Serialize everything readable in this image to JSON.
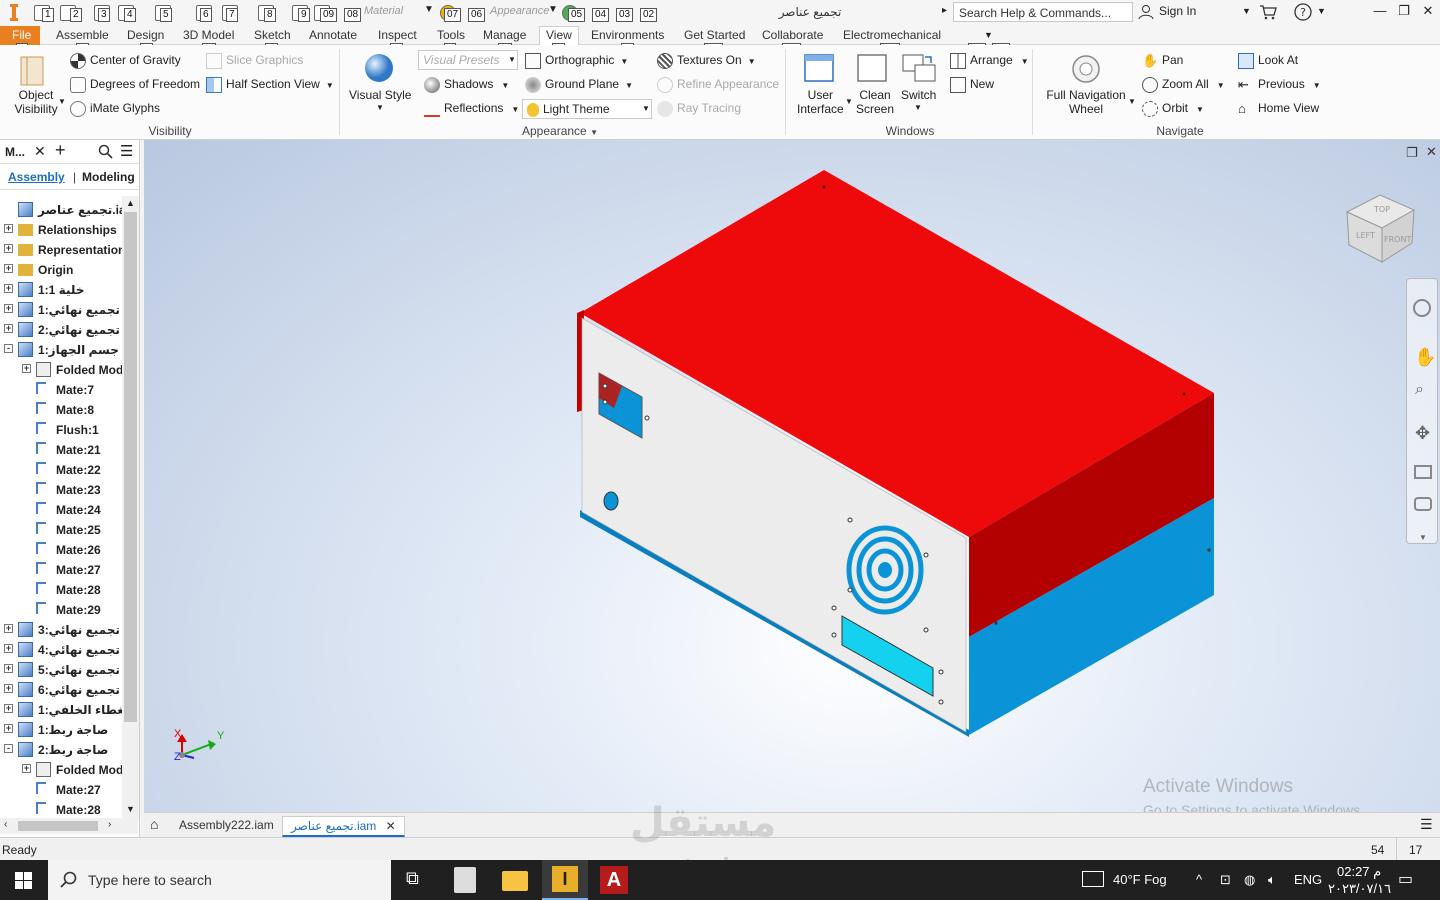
{
  "app": {
    "title": "تجميع عناصر",
    "search_placeholder": "Search Help & Commands...",
    "sign_in": "Sign In",
    "qat_combo1": "Material",
    "qat_combo2": "Appearance",
    "accent": "#e8801f"
  },
  "keytips": {
    "qat": [
      "1",
      "2",
      "3",
      "4",
      "5",
      "6",
      "7",
      "8",
      "9",
      "09",
      "08",
      "07",
      "06",
      "05",
      "04",
      "03",
      "02"
    ],
    "tabs": [
      "F",
      "A",
      "D",
      "M",
      "S",
      "N",
      "T",
      "G",
      "V",
      "E",
      "ZS",
      "OL",
      "ZM",
      "X2",
      "X3"
    ]
  },
  "tabs": [
    {
      "label": "File"
    },
    {
      "label": "Assemble"
    },
    {
      "label": "Design"
    },
    {
      "label": "3D Model"
    },
    {
      "label": "Sketch"
    },
    {
      "label": "Annotate"
    },
    {
      "label": "Inspect"
    },
    {
      "label": "Tools"
    },
    {
      "label": "Manage"
    },
    {
      "label": "View"
    },
    {
      "label": "Environments"
    },
    {
      "label": "Get Started"
    },
    {
      "label": "Collaborate"
    },
    {
      "label": "Electromechanical"
    }
  ],
  "ribbon": {
    "visibility": {
      "object_visibility": "Object\nVisibility",
      "center_gravity": "Center of Gravity",
      "degrees_freedom": "Degrees of Freedom",
      "imate_glyphs": "iMate Glyphs",
      "slice_graphics": "Slice Graphics",
      "half_section": "Half Section View",
      "group": "Visibility"
    },
    "appearance": {
      "visual_style": "Visual Style",
      "visual_presets": "Visual Presets",
      "shadows": "Shadows",
      "reflections": "Reflections",
      "orthographic": "Orthographic",
      "ground_plane": "Ground Plane",
      "light_theme": "Light Theme",
      "textures_on": "Textures On",
      "refine_appearance": "Refine Appearance",
      "ray_tracing": "Ray Tracing",
      "group": "Appearance"
    },
    "windows": {
      "user_interface": "User\nInterface",
      "clean_screen": "Clean\nScreen",
      "switch": "Switch",
      "arrange": "Arrange",
      "new": "New",
      "group": "Windows"
    },
    "navigate": {
      "full_nav_wheel": "Full Navigation\nWheel",
      "pan": "Pan",
      "zoom_all": "Zoom All",
      "orbit": "Orbit",
      "look_at": "Look At",
      "previous": "Previous",
      "home_view": "Home View",
      "group": "Navigate"
    }
  },
  "browser": {
    "title": "M...",
    "tab_assembly": "Assembly",
    "tab_modeling": "Modeling",
    "rows": [
      {
        "label": "تجميع عناصر.iam",
        "kind": "asm",
        "indent": 0,
        "toggle": ""
      },
      {
        "label": "Relationships",
        "kind": "folder",
        "indent": 0,
        "toggle": "+"
      },
      {
        "label": "Representations",
        "kind": "folder",
        "indent": 0,
        "toggle": "+"
      },
      {
        "label": "Origin",
        "kind": "folder",
        "indent": 0,
        "toggle": "+"
      },
      {
        "label": "خلية 1:1",
        "kind": "part",
        "indent": 0,
        "toggle": "+"
      },
      {
        "label": "تجميع نهائي:1",
        "kind": "asm",
        "indent": 0,
        "toggle": "+"
      },
      {
        "label": "تجميع نهائي:2",
        "kind": "asm",
        "indent": 0,
        "toggle": "+"
      },
      {
        "label": "جسم الجهاز:1",
        "kind": "part",
        "indent": 0,
        "toggle": "-"
      },
      {
        "label": "Folded Model",
        "kind": "folded",
        "indent": 1,
        "toggle": "+"
      },
      {
        "label": "Mate:7",
        "kind": "mate",
        "indent": 1,
        "toggle": ""
      },
      {
        "label": "Mate:8",
        "kind": "mate",
        "indent": 1,
        "toggle": ""
      },
      {
        "label": "Flush:1",
        "kind": "flush",
        "indent": 1,
        "toggle": ""
      },
      {
        "label": "Mate:21",
        "kind": "mate",
        "indent": 1,
        "toggle": ""
      },
      {
        "label": "Mate:22",
        "kind": "mate2",
        "indent": 1,
        "toggle": ""
      },
      {
        "label": "Mate:23",
        "kind": "mate",
        "indent": 1,
        "toggle": ""
      },
      {
        "label": "Mate:24",
        "kind": "mate",
        "indent": 1,
        "toggle": ""
      },
      {
        "label": "Mate:25",
        "kind": "mate2",
        "indent": 1,
        "toggle": ""
      },
      {
        "label": "Mate:26",
        "kind": "mate",
        "indent": 1,
        "toggle": ""
      },
      {
        "label": "Mate:27",
        "kind": "mate",
        "indent": 1,
        "toggle": ""
      },
      {
        "label": "Mate:28",
        "kind": "mate2",
        "indent": 1,
        "toggle": ""
      },
      {
        "label": "Mate:29",
        "kind": "mate",
        "indent": 1,
        "toggle": ""
      },
      {
        "label": "تجميع نهائي:3",
        "kind": "asm",
        "indent": 0,
        "toggle": "+"
      },
      {
        "label": "تجميع نهائي:4",
        "kind": "asm",
        "indent": 0,
        "toggle": "+"
      },
      {
        "label": "تجميع نهائي:5",
        "kind": "asm",
        "indent": 0,
        "toggle": "+"
      },
      {
        "label": "تجميع نهائي:6",
        "kind": "asm",
        "indent": 0,
        "toggle": "+"
      },
      {
        "label": "الغطاء الخلفي:1",
        "kind": "part",
        "indent": 0,
        "toggle": "+"
      },
      {
        "label": "صاجة ربط:1",
        "kind": "part",
        "indent": 0,
        "toggle": "+"
      },
      {
        "label": "صاجة ربط:2",
        "kind": "part",
        "indent": 0,
        "toggle": "-"
      },
      {
        "label": "Folded Model",
        "kind": "folded",
        "indent": 1,
        "toggle": "+"
      },
      {
        "label": "Mate:27",
        "kind": "mate2",
        "indent": 1,
        "toggle": ""
      },
      {
        "label": "Mate:28",
        "kind": "mate2",
        "indent": 1,
        "toggle": ""
      }
    ]
  },
  "viewcube": {
    "top": "TOP",
    "left": "LEFT",
    "front": "FRONT"
  },
  "model_colors": {
    "red": "#dd0000",
    "blue": "#0a93d6",
    "panel": "#ececec"
  },
  "triad": {
    "x": "X",
    "y": "Y",
    "z": "Z"
  },
  "doc_tabs": [
    {
      "label": "Assembly222.iam",
      "active": false
    },
    {
      "label": "تجميع عناصر.iam",
      "active": true
    }
  ],
  "status": {
    "text": "Ready",
    "count1": "54",
    "count2": "17"
  },
  "activate": {
    "line1": "Activate Windows",
    "line2": "Go to Settings to activate Windows."
  },
  "watermark": {
    "logo": "مستقل",
    "site": "mostaql.com"
  },
  "taskbar": {
    "search": "Type here to search",
    "weather": "40°F  Fog",
    "lang": "ENG",
    "time": "02:27 م",
    "date": "٢٠٢٣/٠٧/١٦"
  }
}
